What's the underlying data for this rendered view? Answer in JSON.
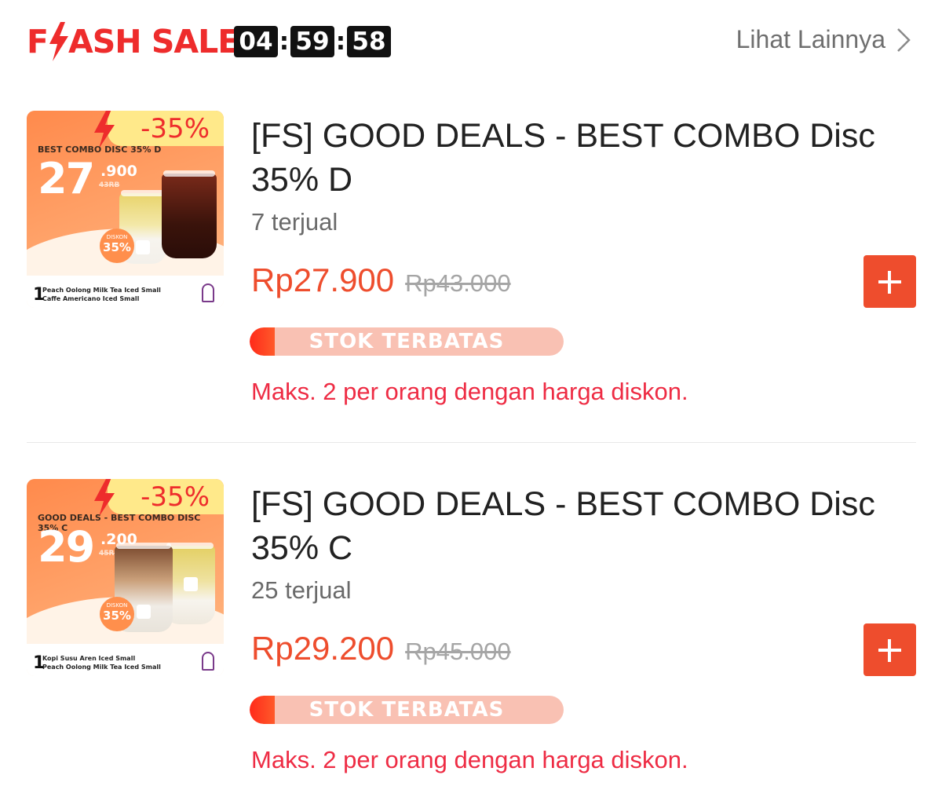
{
  "header": {
    "logo_text_before": "F",
    "logo_text_after": "ASH SALE",
    "timer": {
      "hours": "04",
      "minutes": "59",
      "seconds": "58",
      "separator": ":"
    },
    "see_more_label": "Lihat Lainnya",
    "brand_color": "#ee2c2c"
  },
  "products": [
    {
      "thumb": {
        "discount_label": "-35%",
        "combo_text": "BEST COMBO DISC 35% D",
        "big_price": "27",
        "small_price": ".900",
        "old_price": "43RB",
        "badge_top": "DISKON",
        "badge_value": "35%",
        "desc_number": "1",
        "desc_lines": [
          "Peach Oolong Milk Tea Iced Small",
          "Caffe Americano Iced Small"
        ]
      },
      "title": "[FS] GOOD DEALS - BEST COMBO Disc 35% D",
      "sold": "7 terjual",
      "price": "Rp27.900",
      "old_price": "Rp43.000",
      "stock_label": "STOK TERBATAS",
      "stock_level": 0.08,
      "limit_text": "Maks. 2 per orang dengan harga diskon."
    },
    {
      "thumb": {
        "discount_label": "-35%",
        "combo_text": "GOOD DEALS - BEST COMBO DISC 35% C",
        "big_price": "29",
        "small_price": ".200",
        "old_price": "45RB",
        "badge_top": "DISKON",
        "badge_value": "35%",
        "desc_number": "1",
        "desc_lines": [
          "Kopi Susu Aren Iced Small",
          "Peach Oolong Milk Tea Iced Small"
        ]
      },
      "title": "[FS] GOOD DEALS - BEST COMBO Disc 35% C",
      "sold": "25 terjual",
      "price": "Rp29.200",
      "old_price": "Rp45.000",
      "stock_label": "STOK TERBATAS",
      "stock_level": 0.08,
      "limit_text": "Maks. 2 per orang dengan harga diskon."
    }
  ],
  "colors": {
    "price": "#ee4d2d",
    "stock_fill": "#ff2a1a",
    "stock_bg": "#f9c1b3",
    "limit": "#ee2c44"
  }
}
